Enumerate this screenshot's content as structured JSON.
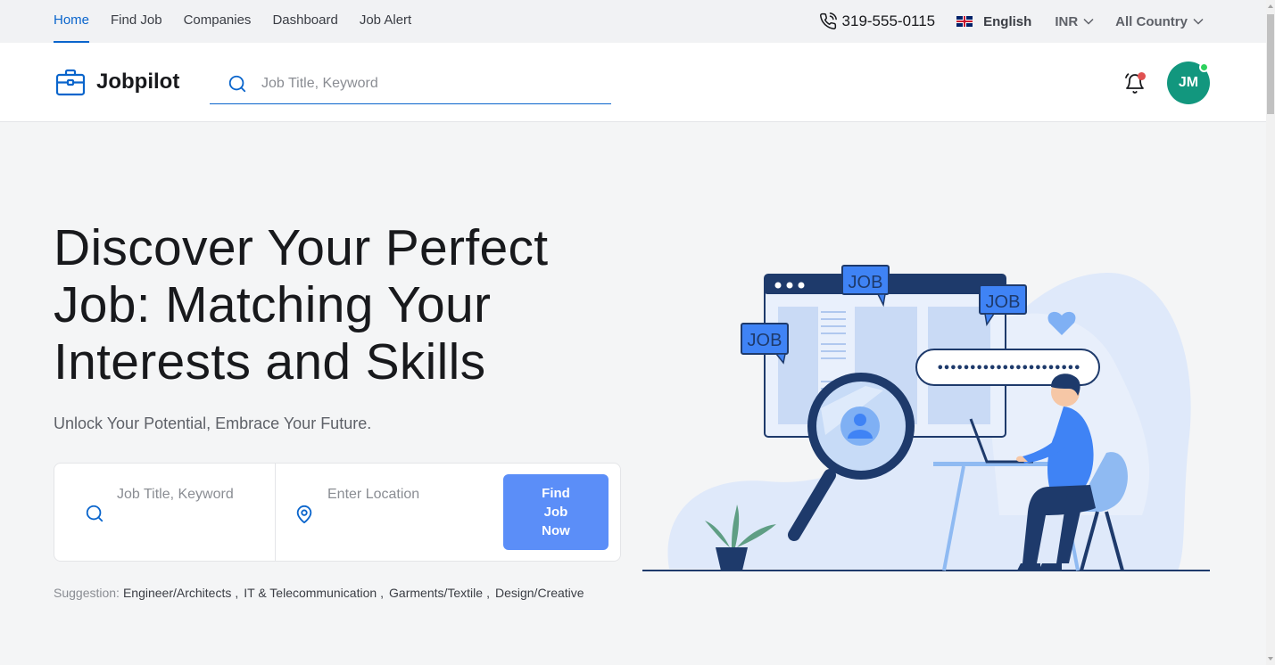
{
  "topnav": {
    "items": [
      {
        "label": "Home",
        "active": true
      },
      {
        "label": "Find Job",
        "active": false
      },
      {
        "label": "Companies",
        "active": false
      },
      {
        "label": "Dashboard",
        "active": false
      },
      {
        "label": "Job Alert",
        "active": false
      }
    ],
    "phone": "319-555-0115",
    "language": "English",
    "currency": "INR",
    "country": "All Country"
  },
  "header": {
    "logo": "Jobpilot",
    "search_placeholder": "Job Title, Keyword",
    "avatar_initials": "JM"
  },
  "hero": {
    "title": "Discover Your Perfect Job: Matching Your Interests and Skills",
    "subtitle": "Unlock Your Potential, Embrace Your Future.",
    "keyword_placeholder": "Job Title, Keyword",
    "location_placeholder": "Enter Location",
    "find_button": "Find Job Now",
    "suggestion_label": "Suggestion:",
    "suggestions": [
      "Engineer/Architects",
      "IT & Telecommunication",
      "Garments/Textile",
      "Design/Creative"
    ]
  },
  "illustration": {
    "tags": [
      "JOB",
      "JOB",
      "JOB"
    ],
    "password_dots": "••••••••••••••••••••••"
  },
  "colors": {
    "primary": "#0a65cc",
    "button": "#5b8ef8",
    "avatar": "#12977e",
    "notification": "#e05151",
    "online": "#2dd15d"
  }
}
